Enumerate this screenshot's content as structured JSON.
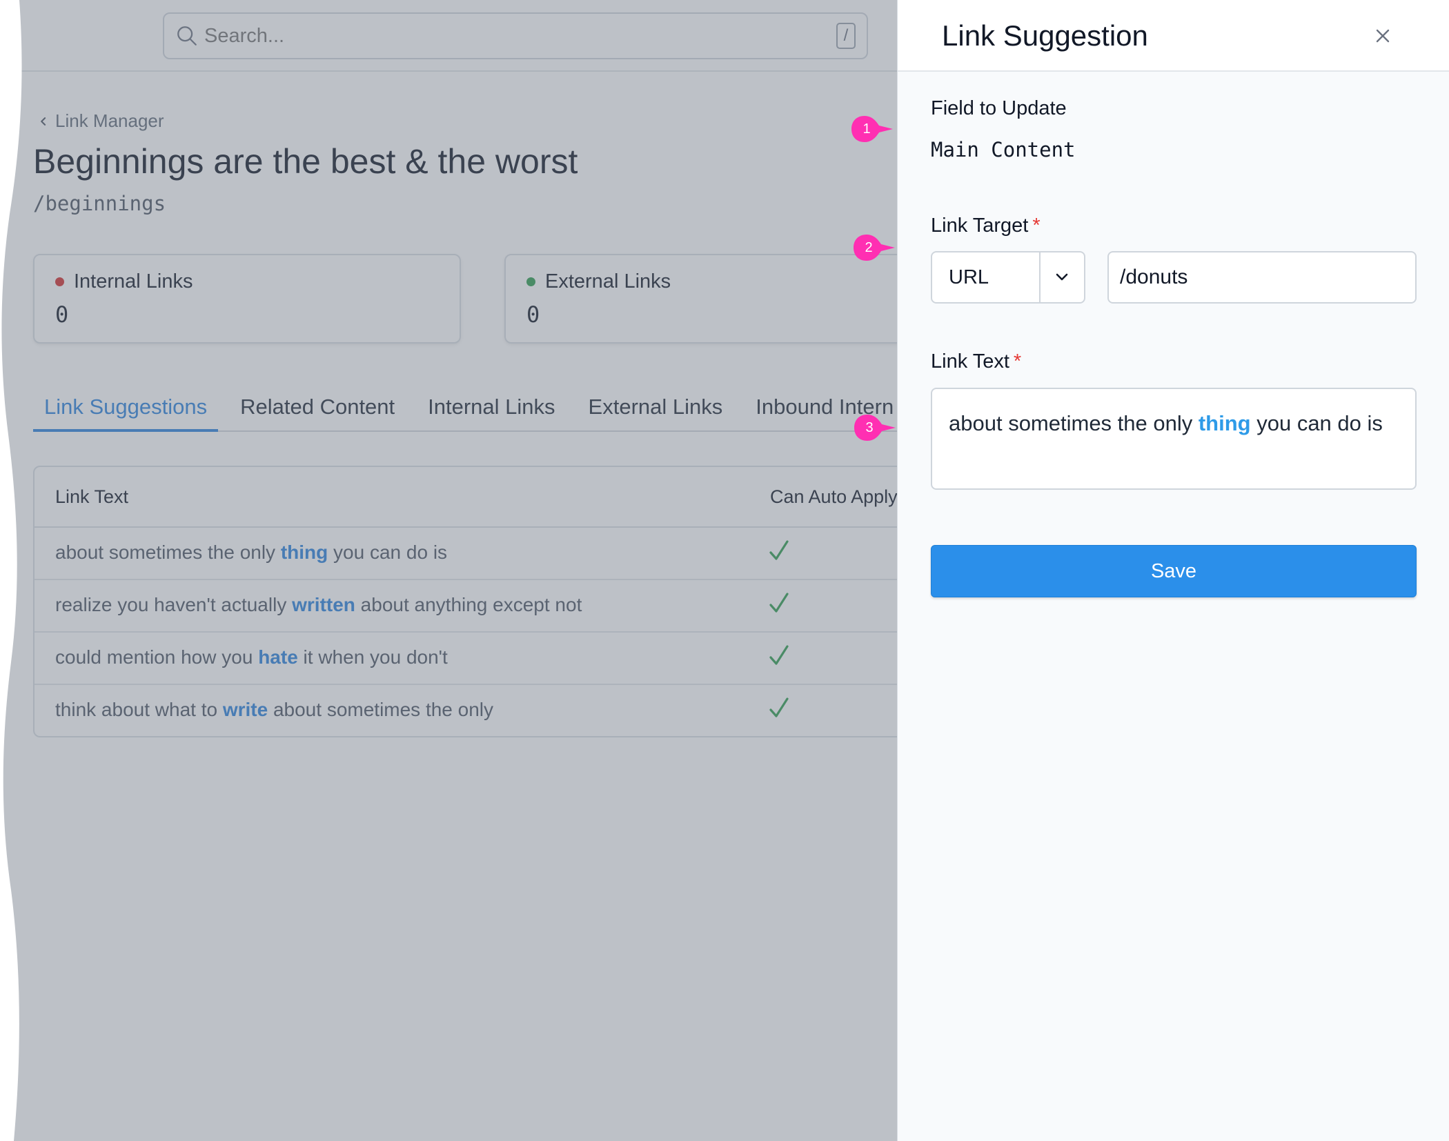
{
  "search": {
    "placeholder": "Search...",
    "shortcut": "/"
  },
  "breadcrumb": {
    "label": "Link Manager"
  },
  "page": {
    "title": "Beginnings are the best & the worst",
    "slug": "/beginnings"
  },
  "stats": [
    {
      "label": "Internal Links",
      "value": "0",
      "dot_color": "#d32f2f"
    },
    {
      "label": "External Links",
      "value": "0",
      "dot_color": "#2e9d4f"
    }
  ],
  "tabs": [
    "Link Suggestions",
    "Related Content",
    "Internal Links",
    "External Links",
    "Inbound Intern"
  ],
  "active_tab": "Link Suggestions",
  "table": {
    "headers": {
      "text": "Link Text",
      "auto": "Can Auto Apply"
    },
    "rows": [
      {
        "before": "about sometimes the only ",
        "keyword": "thing",
        "after": " you can do is",
        "auto_apply": "✓"
      },
      {
        "before": "realize you haven't actually ",
        "keyword": "written",
        "after": " about anything except not",
        "auto_apply": "✓"
      },
      {
        "before": "could mention how you ",
        "keyword": "hate",
        "after": " it when you don't",
        "auto_apply": "✓"
      },
      {
        "before": "think about what to ",
        "keyword": "write",
        "after": " about sometimes the only",
        "auto_apply": "✓"
      }
    ]
  },
  "drawer": {
    "title": "Link Suggestion",
    "field_to_update": {
      "label": "Field to Update",
      "value": "Main Content"
    },
    "link_target": {
      "label": "Link Target",
      "required": "*",
      "type": "URL",
      "value": "/donuts"
    },
    "link_text": {
      "label": "Link Text",
      "required": "*",
      "before": "about sometimes the only ",
      "keyword": "thing",
      "after": " you can do is"
    },
    "save_label": "Save"
  },
  "markers": [
    "1",
    "2",
    "3"
  ],
  "colors": {
    "accent": "#2b82dc",
    "save_button": "#2b8fea",
    "marker": "#ff2fb2",
    "check": "#2e9d4f",
    "required": "#e53935"
  },
  "icons": [
    "search-icon",
    "chevron-left-icon",
    "close-icon",
    "chevron-down-icon",
    "check-icon"
  ]
}
